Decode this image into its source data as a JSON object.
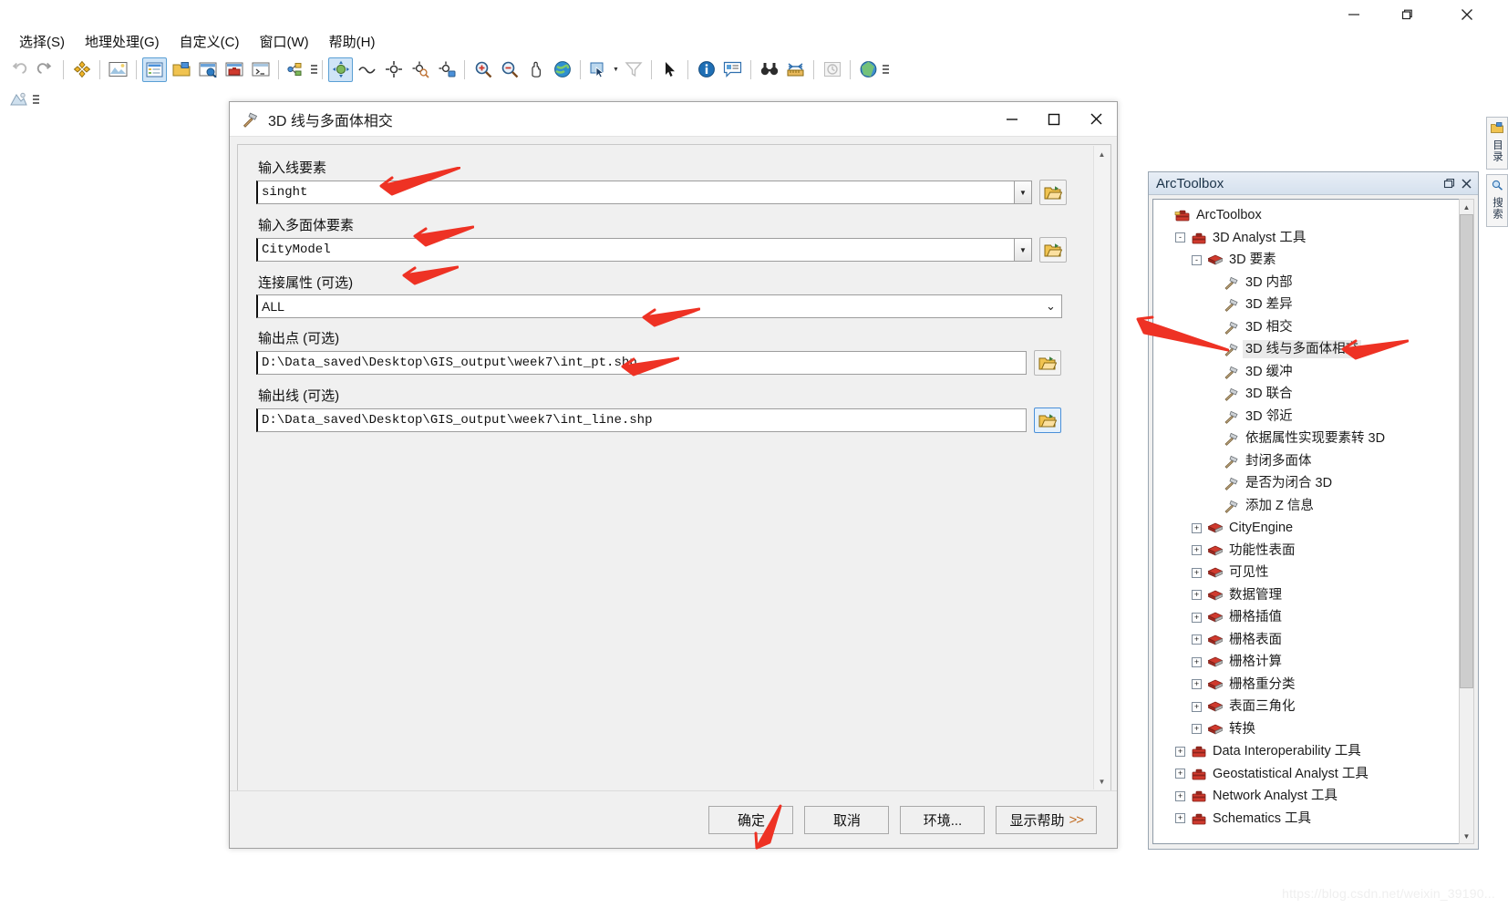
{
  "window": {
    "controls": {
      "minimize": "minimize-icon",
      "maximize": "maximize-icon",
      "close": "close-icon"
    }
  },
  "menubar": {
    "items": [
      {
        "label": ")",
        "name": "menu-clipped"
      },
      {
        "label": "选择(S)",
        "name": "menu-selection"
      },
      {
        "label": "地理处理(G)",
        "name": "menu-geoprocessing"
      },
      {
        "label": "自定义(C)",
        "name": "menu-customize"
      },
      {
        "label": "窗口(W)",
        "name": "menu-window"
      },
      {
        "label": "帮助(H)",
        "name": "menu-help"
      }
    ]
  },
  "toolbar": {
    "items": [
      {
        "name": "undo-icon",
        "active": false
      },
      {
        "name": "redo-icon",
        "active": false
      },
      {
        "name": "sep",
        "active": false
      },
      {
        "name": "editor-add-icon",
        "active": false
      },
      {
        "name": "sep",
        "active": false
      },
      {
        "name": "layout-view-icon",
        "active": false
      },
      {
        "name": "sep",
        "active": false
      },
      {
        "name": "table-of-contents-icon",
        "active": true
      },
      {
        "name": "catalog-window-icon",
        "active": false
      },
      {
        "name": "search-window-icon",
        "active": false
      },
      {
        "name": "arctoolbox-window-icon",
        "active": false
      },
      {
        "name": "python-window-icon",
        "active": false
      },
      {
        "name": "sep",
        "active": false
      },
      {
        "name": "model-builder-icon",
        "active": false
      },
      {
        "name": "overflow-icon",
        "active": false
      },
      {
        "name": "sep",
        "active": false
      },
      {
        "name": "navigate-3d-icon",
        "active": true
      },
      {
        "name": "fly-icon",
        "active": false
      },
      {
        "name": "target-center-icon",
        "active": false
      },
      {
        "name": "zoom-to-target-icon",
        "active": false
      },
      {
        "name": "set-observer-icon",
        "active": false
      },
      {
        "name": "sep",
        "active": false
      },
      {
        "name": "zoom-in-icon",
        "active": false
      },
      {
        "name": "zoom-out-icon",
        "active": false
      },
      {
        "name": "pan-icon",
        "active": false
      },
      {
        "name": "full-extent-globe-icon",
        "active": false
      },
      {
        "name": "sep",
        "active": false
      },
      {
        "name": "select-features-icon",
        "active": false
      },
      {
        "name": "chevron-down-icon",
        "active": false
      },
      {
        "name": "clear-selection-icon",
        "active": false
      },
      {
        "name": "sep",
        "active": false
      },
      {
        "name": "select-elements-icon",
        "active": false
      },
      {
        "name": "sep",
        "active": false
      },
      {
        "name": "identify-icon",
        "active": false
      },
      {
        "name": "html-popup-icon",
        "active": false
      },
      {
        "name": "sep",
        "active": false
      },
      {
        "name": "find-icon",
        "active": false
      },
      {
        "name": "measure-icon",
        "active": false
      },
      {
        "name": "sep",
        "active": false
      },
      {
        "name": "time-slider-icon",
        "active": false
      },
      {
        "name": "sep",
        "active": false
      },
      {
        "name": "animation-icon",
        "active": false
      },
      {
        "name": "overflow2-icon",
        "active": false
      }
    ]
  },
  "toolbar2": {
    "items": [
      {
        "name": "effects-icon",
        "active": false
      },
      {
        "name": "overflow-icon",
        "active": false
      }
    ]
  },
  "dialog": {
    "title": "3D 线与多面体相交",
    "title_icon": "hammer-tool-icon",
    "fields": [
      {
        "name": "input-line-features",
        "label": "输入线要素",
        "value": "singht",
        "kind": "combo",
        "browse": "open-folder-icon",
        "browse_focus": false
      },
      {
        "name": "input-multipatch-features",
        "label": "输入多面体要素",
        "value": "CityModel",
        "kind": "combo",
        "browse": "open-folder-icon",
        "browse_focus": false
      },
      {
        "name": "join-attributes",
        "label": "连接属性 (可选)",
        "value": "ALL",
        "kind": "select",
        "browse": null,
        "browse_focus": false
      },
      {
        "name": "output-points",
        "label": "输出点 (可选)",
        "value": "D:\\Data_saved\\Desktop\\GIS_output\\week7\\int_pt.shp",
        "kind": "text",
        "browse": "open-folder-icon",
        "browse_focus": false
      },
      {
        "name": "output-lines",
        "label": "输出线 (可选)",
        "value": "D:\\Data_saved\\Desktop\\GIS_output\\week7\\int_line.shp",
        "kind": "text",
        "browse": "open-folder-icon",
        "browse_focus": true
      }
    ],
    "buttons": [
      {
        "name": "ok-button",
        "label": "确定",
        "chev": ""
      },
      {
        "name": "cancel-button",
        "label": "取消",
        "chev": ""
      },
      {
        "name": "environments-button",
        "label": "环境...",
        "chev": ""
      },
      {
        "name": "show-help-button",
        "label": "显示帮助",
        "chev": ">>"
      }
    ]
  },
  "arctoolbox": {
    "title": "ArcToolbox",
    "controls": {
      "restore": "restore-icon",
      "close": "close-icon"
    },
    "tree": [
      {
        "label": "ArcToolbox",
        "depth": 0,
        "twist": "",
        "icon": "toolbox-root-icon",
        "selected": false
      },
      {
        "label": "3D Analyst 工具",
        "depth": 1,
        "twist": "-",
        "icon": "toolbox-icon",
        "selected": false
      },
      {
        "label": "3D 要素",
        "depth": 2,
        "twist": "-",
        "icon": "toolset-icon",
        "selected": false
      },
      {
        "label": "3D 内部",
        "depth": 3,
        "twist": "",
        "icon": "hammer-tool-icon",
        "selected": false
      },
      {
        "label": "3D 差异",
        "depth": 3,
        "twist": "",
        "icon": "hammer-tool-icon",
        "selected": false
      },
      {
        "label": "3D 相交",
        "depth": 3,
        "twist": "",
        "icon": "hammer-tool-icon",
        "selected": false
      },
      {
        "label": "3D 线与多面体相交",
        "depth": 3,
        "twist": "",
        "icon": "hammer-tool-icon",
        "selected": true
      },
      {
        "label": "3D 缓冲",
        "depth": 3,
        "twist": "",
        "icon": "hammer-tool-icon",
        "selected": false
      },
      {
        "label": "3D 联合",
        "depth": 3,
        "twist": "",
        "icon": "hammer-tool-icon",
        "selected": false
      },
      {
        "label": "3D 邻近",
        "depth": 3,
        "twist": "",
        "icon": "hammer-tool-icon",
        "selected": false
      },
      {
        "label": "依据属性实现要素转 3D",
        "depth": 3,
        "twist": "",
        "icon": "hammer-tool-icon",
        "selected": false
      },
      {
        "label": "封闭多面体",
        "depth": 3,
        "twist": "",
        "icon": "hammer-tool-icon",
        "selected": false
      },
      {
        "label": "是否为闭合 3D",
        "depth": 3,
        "twist": "",
        "icon": "hammer-tool-icon",
        "selected": false
      },
      {
        "label": "添加 Z 信息",
        "depth": 3,
        "twist": "",
        "icon": "hammer-tool-icon",
        "selected": false
      },
      {
        "label": "CityEngine",
        "depth": 2,
        "twist": "+",
        "icon": "toolset-icon",
        "selected": false
      },
      {
        "label": "功能性表面",
        "depth": 2,
        "twist": "+",
        "icon": "toolset-icon",
        "selected": false
      },
      {
        "label": "可见性",
        "depth": 2,
        "twist": "+",
        "icon": "toolset-icon",
        "selected": false
      },
      {
        "label": "数据管理",
        "depth": 2,
        "twist": "+",
        "icon": "toolset-icon",
        "selected": false
      },
      {
        "label": "栅格插值",
        "depth": 2,
        "twist": "+",
        "icon": "toolset-icon",
        "selected": false
      },
      {
        "label": "栅格表面",
        "depth": 2,
        "twist": "+",
        "icon": "toolset-icon",
        "selected": false
      },
      {
        "label": "栅格计算",
        "depth": 2,
        "twist": "+",
        "icon": "toolset-icon",
        "selected": false
      },
      {
        "label": "栅格重分类",
        "depth": 2,
        "twist": "+",
        "icon": "toolset-icon",
        "selected": false
      },
      {
        "label": "表面三角化",
        "depth": 2,
        "twist": "+",
        "icon": "toolset-icon",
        "selected": false
      },
      {
        "label": "转换",
        "depth": 2,
        "twist": "+",
        "icon": "toolset-icon",
        "selected": false
      },
      {
        "label": "Data Interoperability 工具",
        "depth": 1,
        "twist": "+",
        "icon": "toolbox-icon",
        "selected": false
      },
      {
        "label": "Geostatistical Analyst 工具",
        "depth": 1,
        "twist": "+",
        "icon": "toolbox-icon",
        "selected": false
      },
      {
        "label": "Network Analyst 工具",
        "depth": 1,
        "twist": "+",
        "icon": "toolbox-icon",
        "selected": false
      },
      {
        "label": "Schematics 工具",
        "depth": 1,
        "twist": "+",
        "icon": "toolbox-icon",
        "selected": false
      }
    ]
  },
  "edge_tabs": [
    {
      "name": "edge-tab-catalog",
      "label": "目录",
      "icon": "catalog-icon"
    },
    {
      "name": "edge-tab-search",
      "label": "搜索",
      "icon": "search-icon"
    }
  ],
  "watermark": "https://blog.csdn.net/weixin_39190...",
  "colors": {
    "annotation_arrow": "#ee3224",
    "accent": "#4a90d9",
    "selection": "#cfe4f7"
  }
}
